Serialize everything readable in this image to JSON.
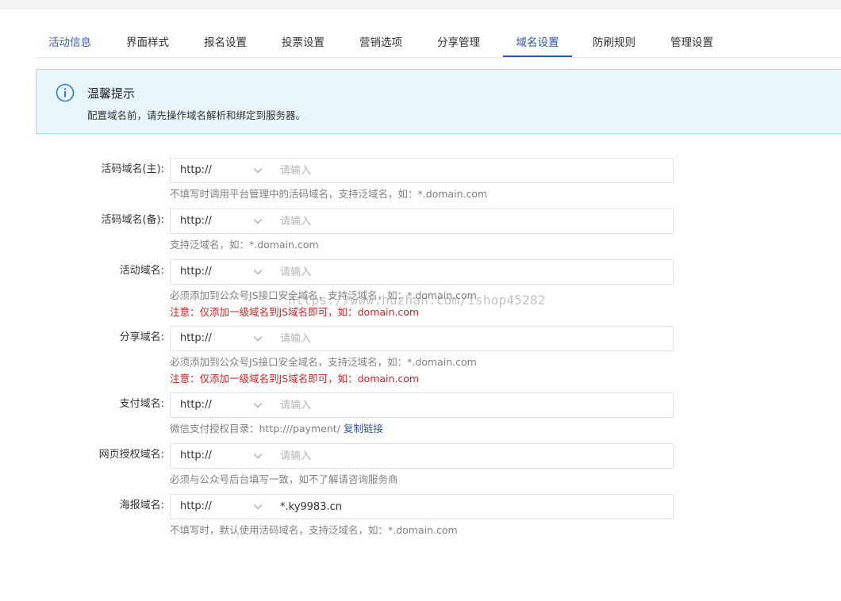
{
  "tabs": [
    "活动信息",
    "界面样式",
    "报名设置",
    "投票设置",
    "营销选项",
    "分享管理",
    "域名设置",
    "防刷规则",
    "管理设置"
  ],
  "active_tab": "域名设置",
  "notice": {
    "icon": "info-icon",
    "title": "温馨提示",
    "desc": "配置域名前，请先操作域名解析和绑定到服务器。"
  },
  "fields": {
    "main": {
      "label": "活码域名(主):",
      "protocol": "http://",
      "placeholder": "请输入",
      "value": "",
      "help": "不填写时调用平台管理中的活码域名，支持泛域名，如：*.domain.com"
    },
    "backup": {
      "label": "活码域名(备):",
      "protocol": "http://",
      "placeholder": "请输入",
      "value": "",
      "help": "支持泛域名，如：*.domain.com"
    },
    "activity": {
      "label": "活动域名:",
      "protocol": "http://",
      "placeholder": "请输入",
      "value": "",
      "help": "必须添加到公众号JS接口安全域名，支持泛域名，如：*.domain.com",
      "warn": "注意：仅添加一级域名到JS域名即可，如：domain.com"
    },
    "share": {
      "label": "分享域名:",
      "protocol": "http://",
      "placeholder": "请输入",
      "value": "",
      "help": "必须添加到公众号JS接口安全域名，支持泛域名，如：*.domain.com",
      "warn": "注意：仅添加一级域名到JS域名即可，如：domain.com"
    },
    "pay": {
      "label": "支付域名:",
      "protocol": "http://",
      "placeholder": "请输入",
      "value": "",
      "help": "微信支付授权目录：http:///payment/",
      "link": "复制链接"
    },
    "auth": {
      "label": "网页授权域名:",
      "protocol": "http://",
      "placeholder": "请输入",
      "value": "",
      "help": "必须与公众号后台填写一致，如不了解请咨询服务商"
    },
    "poster": {
      "label": "海报域名:",
      "protocol": "http://",
      "placeholder": "请输入",
      "value": "*.ky9983.cn",
      "help": "不填写时，默认使用活码域名，支持泛域名，如：*.domain.com"
    }
  },
  "watermark": "https://www.huzhan.com/ishop45282",
  "colors": {
    "accent": "#2f54b0",
    "warn": "#e02020",
    "notice_bg": "#e8f6fc"
  }
}
